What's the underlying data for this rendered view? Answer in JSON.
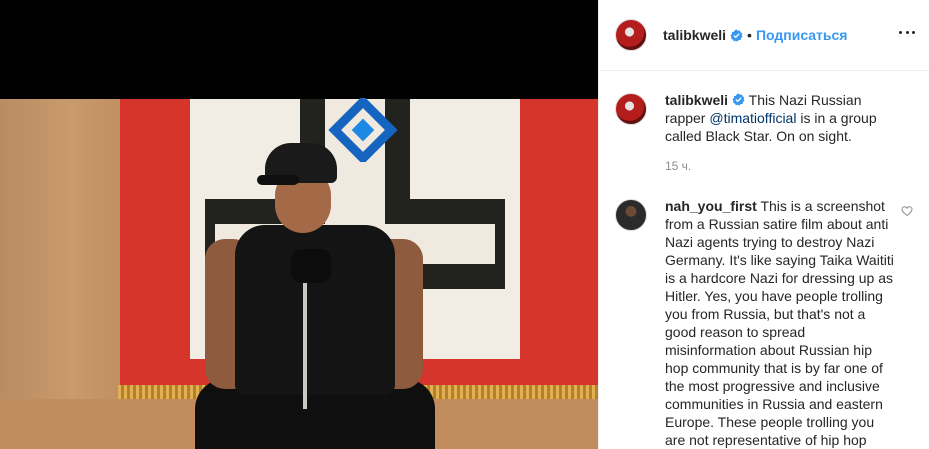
{
  "post": {
    "author": "talibkweli",
    "follow_label": "Подписаться",
    "separator": "•",
    "caption_text": " This Nazi Russian rapper ",
    "caption_mention": "@timatiofficial",
    "caption_rest": " is in a group called Black Star. On on sight.",
    "time_ago": "15 ч."
  },
  "comment": {
    "author": "nah_you_first",
    "text": " This is a screenshot from a Russian satire film about anti Nazi agents trying to destroy Nazi Germany. It's like saying Taika Waititi is a hardcore Nazi for dressing up as Hitler. Yes, you have people trolling you from Russia, but that's not a good reason to spread misinformation about Russian hip hop community that is by far one of the most progressive and inclusive communities in Russia and eastern Europe. These people trolling you are not representative of hip hop culture"
  },
  "icons": {
    "verified": "verified-badge-icon",
    "more": "more-options-icon",
    "heart": "heart-outline-icon",
    "overlay_logo": "blue-diamond-logo"
  },
  "colors": {
    "link": "#3897f0",
    "mention": "#003569",
    "muted": "#8e8e8e",
    "verified": "#3897f0"
  }
}
